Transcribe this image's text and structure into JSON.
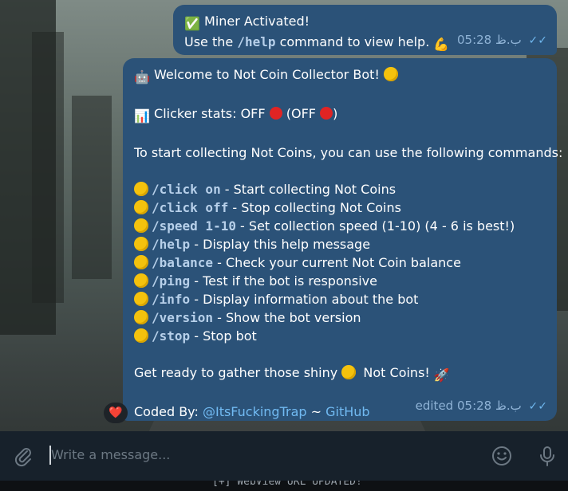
{
  "message1": {
    "line1_emoji": "✅",
    "line1_text": "Miner Activated!",
    "line2_prefix": "Use the ",
    "line2_cmd": "/help",
    "line2_suffix": " command to view help.",
    "line2_emoji": "💪",
    "time": "05:28 ب.ظ"
  },
  "message2": {
    "welcome_emoji": "🤖",
    "welcome_text": "Welcome to Not Coin Collector Bot!",
    "stats_emoji": "📊",
    "stats_text": "Clicker stats: OFF",
    "stats_mid": "(OFF",
    "stats_end": ")",
    "intro": "To start collecting Not Coins, you can use the following commands:",
    "commands": [
      {
        "cmd": "/click on",
        "desc": " - Start collecting Not Coins"
      },
      {
        "cmd": "/click off",
        "desc": " - Stop collecting Not Coins"
      },
      {
        "cmd": "/speed 1-10",
        "desc": " - Set collection speed (1-10) (4 - 6 is best!)"
      },
      {
        "cmd": "/help",
        "desc": " - Display this help message"
      },
      {
        "cmd": "/balance",
        "desc": " - Check your current Not Coin balance"
      },
      {
        "cmd": "/ping",
        "desc": " - Test if the bot is responsive"
      },
      {
        "cmd": "/info",
        "desc": " - Display information about the bot"
      },
      {
        "cmd": "/version",
        "desc": " - Show the bot version"
      },
      {
        "cmd": "/stop",
        "desc": " - Stop bot"
      }
    ],
    "outro_a": "Get ready to gather those shiny",
    "outro_b": "Not Coins!",
    "outro_emoji": "🚀",
    "coded_by": "Coded By: ",
    "author_link": "@ItsFuckingTrap",
    "sep": " ~ ",
    "github_link": "GitHub",
    "edited": "edited",
    "time": "05:28 ب.ظ"
  },
  "reaction": "❤️",
  "composer": {
    "placeholder": "Write a message..."
  },
  "terminal_strip": "[+] WebView URL UPDATED!",
  "icons": [
    "attach-icon",
    "emoji-icon",
    "mic-icon",
    "read-checkmarks-icon"
  ]
}
